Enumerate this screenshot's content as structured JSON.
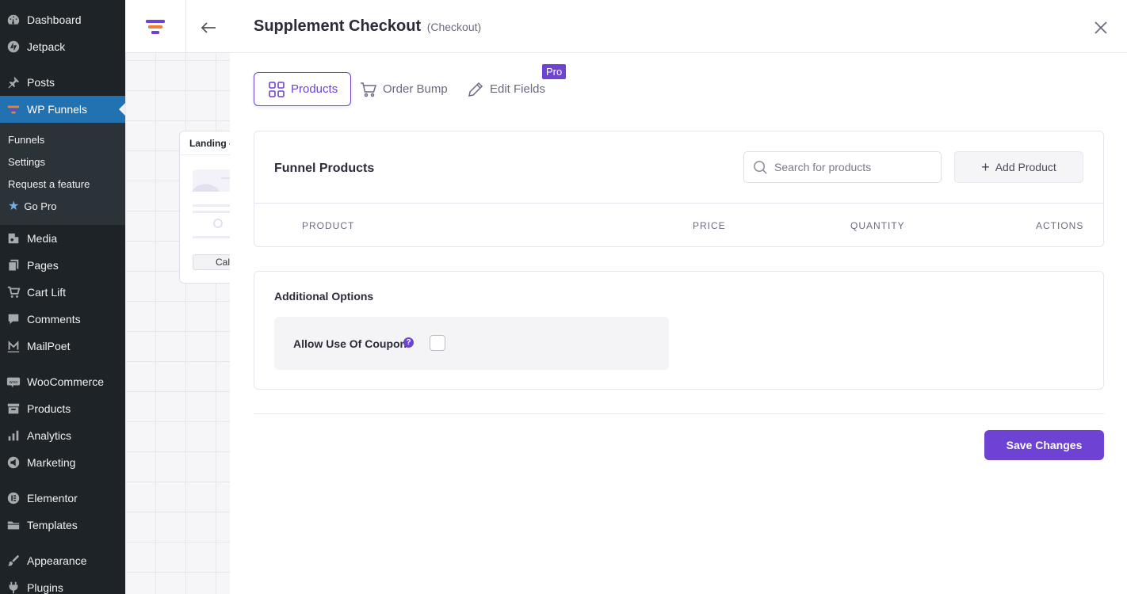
{
  "sidebar": {
    "items": [
      {
        "name": "dashboard",
        "label": "Dashboard",
        "icon": "dashboard-icon"
      },
      {
        "name": "jetpack",
        "label": "Jetpack",
        "icon": "jetpack-icon"
      },
      {
        "name": "posts",
        "label": "Posts",
        "icon": "pin-icon"
      },
      {
        "name": "wp-funnels",
        "label": "WP Funnels",
        "icon": "funnel-icon"
      },
      {
        "name": "media",
        "label": "Media",
        "icon": "media-icon"
      },
      {
        "name": "pages",
        "label": "Pages",
        "icon": "pages-icon"
      },
      {
        "name": "cart-lift",
        "label": "Cart Lift",
        "icon": "cart-icon"
      },
      {
        "name": "comments",
        "label": "Comments",
        "icon": "comment-icon"
      },
      {
        "name": "mailpoet",
        "label": "MailPoet",
        "icon": "mailpoet-icon"
      },
      {
        "name": "woocommerce",
        "label": "WooCommerce",
        "icon": "woo-icon"
      },
      {
        "name": "products",
        "label": "Products",
        "icon": "archive-icon"
      },
      {
        "name": "analytics",
        "label": "Analytics",
        "icon": "bar-chart-icon"
      },
      {
        "name": "marketing",
        "label": "Marketing",
        "icon": "megaphone-icon"
      },
      {
        "name": "elementor",
        "label": "Elementor",
        "icon": "elementor-icon"
      },
      {
        "name": "templates",
        "label": "Templates",
        "icon": "folder-icon"
      },
      {
        "name": "appearance",
        "label": "Appearance",
        "icon": "brush-icon"
      },
      {
        "name": "plugins",
        "label": "Plugins",
        "icon": "plug-icon"
      }
    ],
    "submenu": [
      {
        "label": "Funnels"
      },
      {
        "label": "Settings"
      },
      {
        "label": "Request a feature"
      },
      {
        "label": "Go Pro",
        "icon": "star-icon"
      }
    ]
  },
  "canvas": {
    "node_title": "Landing -",
    "node_button": "Call"
  },
  "modal": {
    "title": "Supplement Checkout",
    "subtitle": "(Checkout)",
    "tabs": [
      {
        "label": "Products",
        "icon": "grid-icon",
        "active": true
      },
      {
        "label": "Order Bump",
        "icon": "cart-icon",
        "active": false
      },
      {
        "label": "Edit Fields",
        "icon": "pencil-icon",
        "active": false,
        "badge": "Pro"
      }
    ],
    "funnel_products": {
      "heading": "Funnel Products",
      "search_placeholder": "Search for products",
      "search_value": "",
      "add_button": "Add Product",
      "columns": [
        "PRODUCT",
        "PRICE",
        "QUANTITY",
        "ACTIONS"
      ],
      "rows": []
    },
    "additional_options": {
      "heading": "Additional Options",
      "coupon_label": "Allow Use Of Coupon",
      "coupon_help": "?",
      "coupon_checked": false
    },
    "save_button": "Save Changes"
  },
  "colors": {
    "accent": "#6e42d3",
    "wp_sidebar": "#1d2327",
    "wp_active": "#2271b1"
  }
}
